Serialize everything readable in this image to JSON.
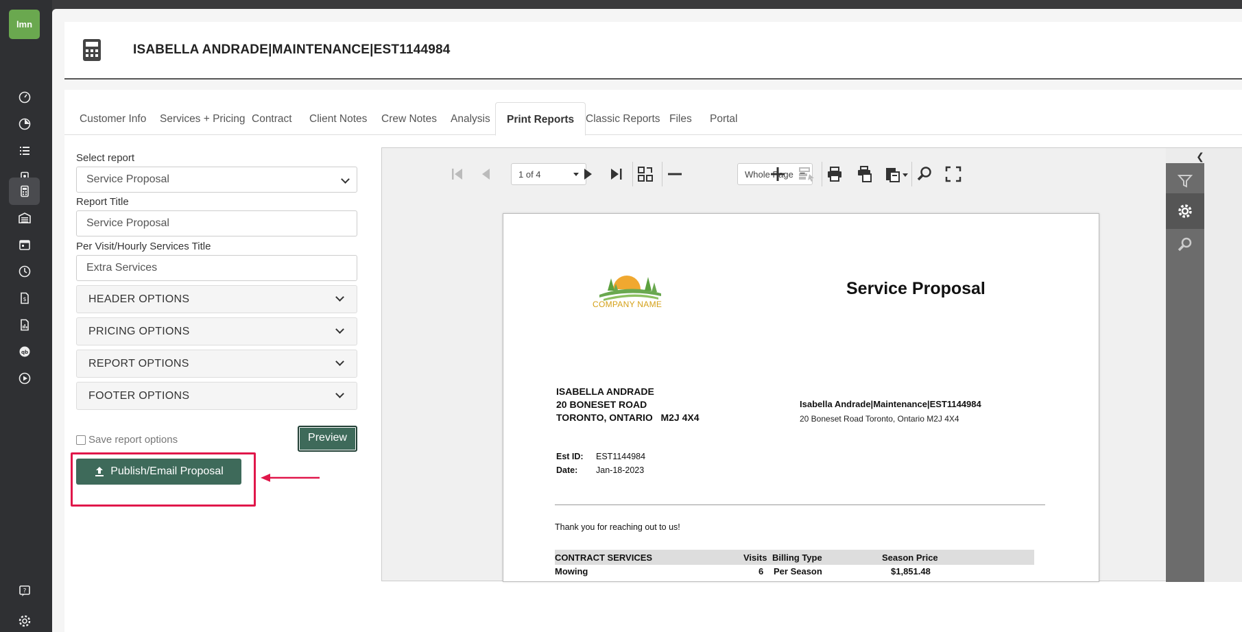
{
  "app": {
    "logo_text": "lmn"
  },
  "header": {
    "title": "ISABELLA ANDRADE|MAINTENANCE|EST1144984"
  },
  "tabs": [
    {
      "label": "Customer Info"
    },
    {
      "label": "Services + Pricing"
    },
    {
      "label": "Contract"
    },
    {
      "label": "Client Notes"
    },
    {
      "label": "Crew Notes"
    },
    {
      "label": "Analysis"
    },
    {
      "label": "Print Reports",
      "active": true
    },
    {
      "label": "Classic Reports"
    },
    {
      "label": "Files"
    },
    {
      "label": "Portal"
    }
  ],
  "form": {
    "select_report_label": "Select report",
    "select_report_value": "Service Proposal",
    "report_title_label": "Report Title",
    "report_title_value": "Service Proposal",
    "per_visit_label": "Per Visit/Hourly Services Title",
    "per_visit_value": "Extra Services",
    "sections": [
      "HEADER OPTIONS",
      "PRICING OPTIONS",
      "REPORT OPTIONS",
      "FOOTER OPTIONS"
    ],
    "save_options_label": "Save report options",
    "save_options_checked": false,
    "preview_label": "Preview",
    "publish_label": "Publish/Email Proposal"
  },
  "viewer": {
    "page_indicator": "1 of 4",
    "zoom_mode": "Whole Page"
  },
  "document": {
    "company_name": "COMPANY NAME",
    "title": "Service Proposal",
    "customer_name": "ISABELLA ANDRADE",
    "customer_street": "20 BONESET ROAD",
    "customer_city": "TORONTO, ONTARIO   M2J 4X4",
    "job_line": "Isabella Andrade|Maintenance|EST1144984",
    "job_address": "20 Boneset Road Toronto, Ontario M2J 4X4",
    "est_id_label": "Est ID:",
    "est_id": "EST1144984",
    "date_label": "Date:",
    "date": "Jan-18-2023",
    "thanks": "Thank you for reaching out to us!",
    "table_headers": {
      "service": "CONTRACT SERVICES",
      "visits": "Visits",
      "billing": "Billing Type",
      "price": "Season Price"
    },
    "rows": [
      {
        "service": "Mowing",
        "visits": "6",
        "billing": "Per Season",
        "price": "$1,851.48"
      }
    ]
  },
  "colors": {
    "accent_green": "#3e6a5a",
    "highlight_red": "#e0174a",
    "logo_green": "#6aa84f"
  }
}
